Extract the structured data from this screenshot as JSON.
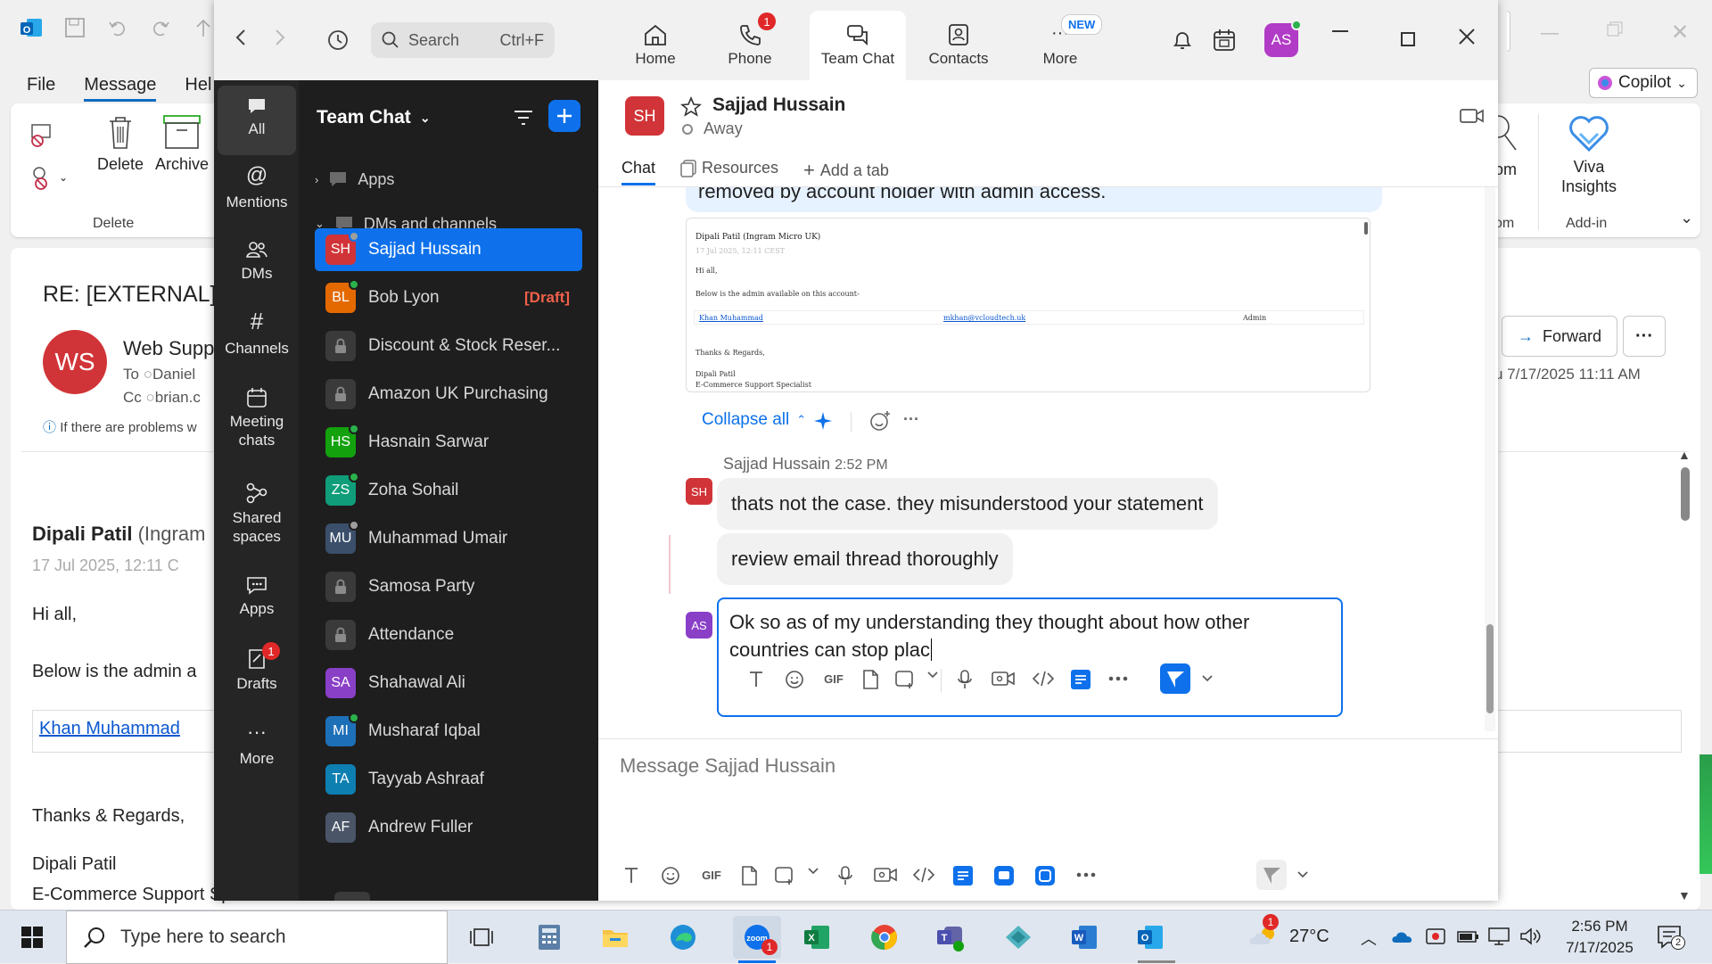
{
  "outlook": {
    "menu": [
      "File",
      "Message",
      "Hel"
    ],
    "ribbon": {
      "delete": "Delete",
      "archive": "Archive",
      "group_delete": "Delete",
      "zoom_partial": "om",
      "group_zoom_partial": "om",
      "viva": "Viva Insights",
      "group_addin": "Add-in",
      "copilot": "Copilot"
    },
    "mail": {
      "subject": "RE: [EXTERNAL]",
      "avatar": "WS",
      "sender": "Web Supp",
      "to_label": "To",
      "to": "Daniel",
      "cc_label": "Cc",
      "cc": "brian.c",
      "info": "If there are problems w",
      "forward": "Forward",
      "date": "u 7/17/2025 11:11 AM",
      "body_sender": "Dipali Patil",
      "body_sender_org": "(Ingram",
      "body_date": "17 Jul 2025, 12:11 C",
      "hi": "Hi all,",
      "below": "Below is the admin a",
      "link": "Khan Muhammad",
      "thanks": "Thanks & Regards,",
      "sig_name": "Dipali Patil",
      "sig_title": "E-Commerce Support Specialist"
    }
  },
  "zoom": {
    "search_placeholder": "Search",
    "search_shortcut": "Ctrl+F",
    "tabs": [
      {
        "label": "Home"
      },
      {
        "label": "Phone",
        "badge": "1"
      },
      {
        "label": "Team Chat"
      },
      {
        "label": "Contacts"
      },
      {
        "label": "More",
        "badge": "NEW"
      }
    ],
    "user_avatar": "AS",
    "rail": [
      {
        "label": "All"
      },
      {
        "label": "Mentions"
      },
      {
        "label": "DMs"
      },
      {
        "label": "Channels"
      },
      {
        "label": "Meeting chats"
      },
      {
        "label": "Shared spaces"
      },
      {
        "label": "Apps"
      },
      {
        "label": "Drafts",
        "badge": "1"
      },
      {
        "label": "More"
      }
    ],
    "panel": {
      "title": "Team Chat",
      "section_apps": "Apps",
      "section_dms": "DMs and channels",
      "items": [
        {
          "initials": "SH",
          "name": "Sajjad Hussain",
          "color": "#d13438",
          "status": "#9e9e9e"
        },
        {
          "initials": "BL",
          "name": "Bob Lyon",
          "color": "#e46a00",
          "status": "#2bb24c",
          "draft": "[Draft]"
        },
        {
          "initials": "",
          "name": "Discount & Stock Reser...",
          "lock": true
        },
        {
          "initials": "",
          "name": "Amazon UK Purchasing",
          "lock": true
        },
        {
          "initials": "HS",
          "name": "Hasnain Sarwar",
          "color": "#13a10e",
          "status": "#2bb24c"
        },
        {
          "initials": "ZS",
          "name": "Zoha Sohail",
          "color": "#0f9d7a",
          "status": "#2bb24c"
        },
        {
          "initials": "MU",
          "name": "Muhammad Umair",
          "color": "#3b4f6b",
          "status": "#9e9e9e"
        },
        {
          "initials": "",
          "name": "Samosa Party",
          "lock": true
        },
        {
          "initials": "",
          "name": "Attendance",
          "lock": true
        },
        {
          "initials": "SA",
          "name": "Shahawal Ali",
          "color": "#8a3fc7",
          "status": ""
        },
        {
          "initials": "MI",
          "name": "Musharaf Iqbal",
          "color": "#1d6fb8",
          "status": "#2bb24c"
        },
        {
          "initials": "TA",
          "name": "Tayyab Ashraaf",
          "color": "#0e7fb1",
          "status": ""
        },
        {
          "initials": "AF",
          "name": "Andrew Fuller",
          "color": "#4a5568",
          "status": ""
        }
      ]
    },
    "chat": {
      "contact_initials": "SH",
      "contact_name": "Sajjad Hussain",
      "contact_status": "Away",
      "tabs": [
        "Chat",
        "Resources",
        "Add a tab"
      ],
      "prev_msg": "removed by account holder with admin access.",
      "attachment": {
        "from": "Dipali Patil (Ingram Micro UK)",
        "date": "17 Jul 2025, 12:11 CEST",
        "hi": "Hi all,",
        "line": "Below is the admin available on this account-",
        "name": "Khan Muhammad",
        "email": "mkhan@vcloudtech.uk",
        "role": "Admin",
        "thanks": "Thanks & Regards,",
        "sig1": "Dipali Patil",
        "sig2": "E-Commerce Support Specialist"
      },
      "collapse": "Collapse all",
      "msg_sender": "Sajjad Hussain",
      "msg_time": "2:52 PM",
      "msg_avatar": "SH",
      "msg1": "thats not the case. they misunderstood your statement",
      "msg2": "review email thread thoroughly",
      "reply_avatar": "AS",
      "reply_text": "Ok so as of my understanding they thought about how other countries can stop plac",
      "compose_placeholder": "Message Sajjad Hussain"
    }
  },
  "taskbar": {
    "search_placeholder": "Type here to search",
    "weather": "27°C",
    "weather_badge": "1",
    "zoom_badge": "1",
    "time": "2:56 PM",
    "date": "7/17/2025",
    "notif": "2"
  }
}
